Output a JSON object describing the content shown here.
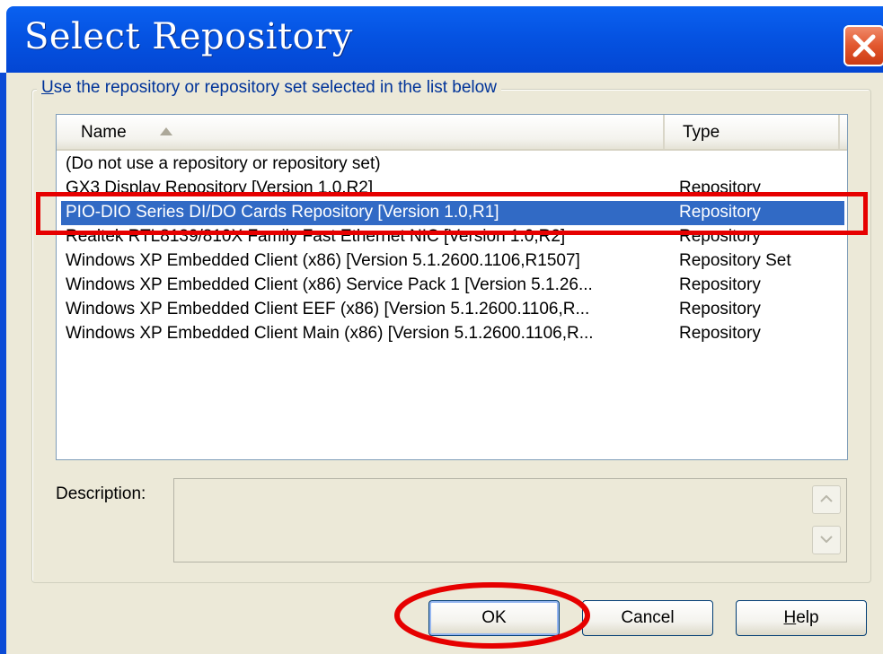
{
  "window": {
    "title": "Select Repository",
    "close_icon": "close-icon"
  },
  "group": {
    "legend_prefix": "U",
    "legend_rest": "se the repository or repository set selected in the list below"
  },
  "list": {
    "columns": [
      {
        "label": "Name",
        "sort": "ascending",
        "sort_icon": "sort-ascending-icon"
      },
      {
        "label": "Type"
      }
    ],
    "rows": [
      {
        "name": "(Do not use a repository or repository set)",
        "type": ""
      },
      {
        "name": "GX3 Display Repository [Version 1.0,R2]",
        "type": "Repository"
      },
      {
        "name": "PIO-DIO Series DI/DO Cards Repository [Version 1.0,R1]",
        "type": "Repository",
        "selected": true
      },
      {
        "name": "Realtek RTL8139/810X Family Fast Ethernet NIC [Version 1.0,R2]",
        "type": "Repository"
      },
      {
        "name": "Windows XP Embedded Client (x86) [Version 5.1.2600.1106,R1507]",
        "type": "Repository Set"
      },
      {
        "name": "Windows XP Embedded Client (x86) Service Pack 1 [Version 5.1.26...",
        "type": "Repository"
      },
      {
        "name": "Windows XP Embedded Client EEF (x86) [Version 5.1.2600.1106,R...",
        "type": "Repository"
      },
      {
        "name": "Windows XP Embedded Client Main (x86) [Version 5.1.2600.1106,R...",
        "type": "Repository"
      }
    ]
  },
  "description": {
    "label": "Description:",
    "value": ""
  },
  "buttons": {
    "ok": "OK",
    "cancel": "Cancel",
    "help_prefix": "H",
    "help_rest": "elp"
  },
  "colors": {
    "titlebar": "#0553e2",
    "selection": "#316ac5",
    "annotation": "#e60000",
    "dialog_bg": "#ece9d8"
  }
}
